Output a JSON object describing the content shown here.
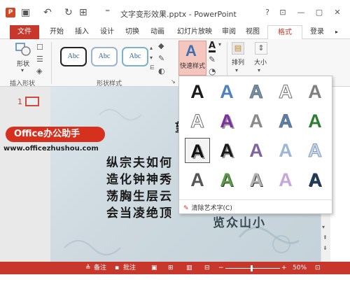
{
  "window": {
    "title": "文字变形效果.pptx - PowerPoint",
    "help": "?",
    "ribbon_display": "⊡",
    "minimize": "—",
    "restore": "▢",
    "close": "✕",
    "app_icon": "P"
  },
  "quick_access": {
    "save": "▣",
    "undo": "↶",
    "redo": "↻",
    "print_preview": "⊞",
    "customize": "⁼"
  },
  "tabs": [
    "文件",
    "开始",
    "插入",
    "设计",
    "切换",
    "动画",
    "幻灯片放映",
    "审阅",
    "视图",
    "格式",
    "登录"
  ],
  "active_tab": "格式",
  "ribbon": {
    "insert_shapes": {
      "shapes_label": "形状",
      "group_label": "插入形状"
    },
    "shape_styles": {
      "samples": [
        "Abc",
        "Abc",
        "Abc"
      ],
      "group_label": "形状样式"
    },
    "wordart": {
      "quick_styles_label": "快速样式",
      "letter": "A"
    },
    "arrange_label": "排列",
    "size_label": "大小"
  },
  "slides_pane": {
    "slide_number": "1"
  },
  "slide": {
    "lines": [
      "纵宗夫如何",
      "造化钟神秀",
      "荡胸生层云",
      "会当凌绝顶"
    ],
    "top_char": "望",
    "partial_right": "览众山小"
  },
  "wordart_gallery": {
    "glyph": "A",
    "selected_index": 10,
    "clear_label": "清除艺术字(C)",
    "styles": [
      {
        "color": "#1a1a1a",
        "effect": "plain"
      },
      {
        "color": "#4f81bd",
        "effect": "gradient"
      },
      {
        "color": "#6d93b3",
        "effect": "outline-fill"
      },
      {
        "color": "#ffffff",
        "effect": "outline-grey"
      },
      {
        "color": "#7f7f7f",
        "effect": "grey"
      },
      {
        "color": "#ffffff",
        "effect": "outline-grey"
      },
      {
        "color": "#7f2fa0",
        "effect": "purple-shadow"
      },
      {
        "color": "#8a8a8a",
        "effect": "silver"
      },
      {
        "color": "#4f81bd",
        "effect": "outline-blue"
      },
      {
        "color": "#2e7d32",
        "effect": "green"
      },
      {
        "color": "#111111",
        "effect": "bold-selected"
      },
      {
        "color": "#1a1a1a",
        "effect": "shadow"
      },
      {
        "color": "#8064a2",
        "effect": "purple"
      },
      {
        "color": "#9fb7d4",
        "effect": "light-blue"
      },
      {
        "color": "#c8d7e6",
        "effect": "pale"
      },
      {
        "color": "#555555",
        "effect": "dark-grey"
      },
      {
        "color": "#5a9a48",
        "effect": "green-bevel"
      },
      {
        "color": "#b0b0b0",
        "effect": "silver-bevel"
      },
      {
        "color": "#c7a7d9",
        "effect": "lavender"
      },
      {
        "color": "#1f3b5c",
        "effect": "navy-texture"
      }
    ]
  },
  "status_bar": {
    "notes": "备注",
    "comments": "批注",
    "zoom": "50%",
    "zoom_fraction": 0.5
  },
  "watermark": {
    "badge": "Office办公助手",
    "url": "www.officezhushou.com"
  },
  "colors": {
    "accent": "#c8372b"
  }
}
